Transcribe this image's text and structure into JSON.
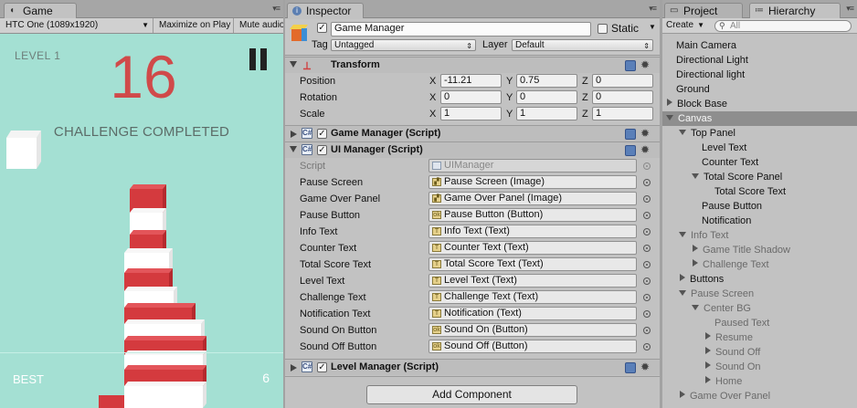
{
  "game": {
    "tab_label": "Game",
    "resolution": "HTC One (1089x1920)",
    "maximize": "Maximize on Play",
    "mute": "Mute audio",
    "level": "LEVEL 1",
    "counter": "16",
    "challenge": "CHALLENGE COMPLETED",
    "best_label": "BEST",
    "best_value": "6",
    "colors": {
      "background": "#a4e0d3",
      "red": "#d43a3e",
      "white": "#ffffff"
    }
  },
  "inspector": {
    "tab_label": "Inspector",
    "object_name": "Game Manager",
    "static_label": "Static",
    "tag_label": "Tag",
    "tag_value": "Untagged",
    "layer_label": "Layer",
    "layer_value": "Default",
    "transform": {
      "title": "Transform",
      "rows": [
        {
          "label": "Position",
          "x": "-11.21",
          "y": "0.75",
          "z": "0"
        },
        {
          "label": "Rotation",
          "x": "0",
          "y": "0",
          "z": "0"
        },
        {
          "label": "Scale",
          "x": "1",
          "y": "1",
          "z": "1"
        }
      ],
      "x_label": "X",
      "y_label": "Y",
      "z_label": "Z"
    },
    "game_manager_title": "Game Manager (Script)",
    "ui_manager_title": "UI Manager (Script)",
    "script_label": "Script",
    "script_value": "UIManager",
    "fields": [
      {
        "label": "Pause Screen",
        "value": "Pause Screen (Image)"
      },
      {
        "label": "Game Over Panel",
        "value": "Game Over Panel (Image)"
      },
      {
        "label": "Pause Button",
        "value": "Pause Button (Button)"
      },
      {
        "label": "Info Text",
        "value": "Info Text (Text)"
      },
      {
        "label": "Counter Text",
        "value": "Counter Text (Text)"
      },
      {
        "label": "Total Score Text",
        "value": "Total Score Text (Text)"
      },
      {
        "label": "Level Text",
        "value": "Level Text (Text)"
      },
      {
        "label": "Challenge Text",
        "value": "Challenge Text (Text)"
      },
      {
        "label": "Notification Text",
        "value": "Notification (Text)"
      },
      {
        "label": "Sound On Button",
        "value": "Sound On (Button)"
      },
      {
        "label": "Sound Off Button",
        "value": "Sound Off (Button)"
      }
    ],
    "level_manager_title": "Level Manager (Script)",
    "add_component": "Add Component"
  },
  "hierarchy": {
    "project_tab": "Project",
    "hierarchy_tab": "Hierarchy",
    "create_label": "Create",
    "search_placeholder": "All",
    "items": [
      {
        "label": "Main Camera",
        "depth": 0,
        "fold": "none",
        "state": "normal"
      },
      {
        "label": "Directional Light",
        "depth": 0,
        "fold": "none",
        "state": "normal"
      },
      {
        "label": "Directional light",
        "depth": 0,
        "fold": "none",
        "state": "normal"
      },
      {
        "label": "Ground",
        "depth": 0,
        "fold": "none",
        "state": "normal"
      },
      {
        "label": "Block Base",
        "depth": 0,
        "fold": "closed",
        "state": "normal"
      },
      {
        "label": "Canvas",
        "depth": 0,
        "fold": "open",
        "state": "selected"
      },
      {
        "label": "Top Panel",
        "depth": 1,
        "fold": "open",
        "state": "normal"
      },
      {
        "label": "Level Text",
        "depth": 2,
        "fold": "none",
        "state": "normal"
      },
      {
        "label": "Counter Text",
        "depth": 2,
        "fold": "none",
        "state": "normal"
      },
      {
        "label": "Total Score Panel",
        "depth": 2,
        "fold": "open",
        "state": "normal"
      },
      {
        "label": "Total Score Text",
        "depth": 3,
        "fold": "none",
        "state": "normal"
      },
      {
        "label": "Pause Button",
        "depth": 2,
        "fold": "none",
        "state": "normal"
      },
      {
        "label": "Notification",
        "depth": 2,
        "fold": "none",
        "state": "normal"
      },
      {
        "label": "Info Text",
        "depth": 1,
        "fold": "open",
        "state": "inactive"
      },
      {
        "label": "Game Title Shadow",
        "depth": 2,
        "fold": "closed",
        "state": "inactive"
      },
      {
        "label": "Challenge Text",
        "depth": 2,
        "fold": "closed",
        "state": "inactive"
      },
      {
        "label": "Buttons",
        "depth": 1,
        "fold": "closed",
        "state": "normal"
      },
      {
        "label": "Pause Screen",
        "depth": 1,
        "fold": "open",
        "state": "inactive"
      },
      {
        "label": "Center BG",
        "depth": 2,
        "fold": "open",
        "state": "inactive"
      },
      {
        "label": "Paused Text",
        "depth": 3,
        "fold": "none",
        "state": "inactive"
      },
      {
        "label": "Resume",
        "depth": 3,
        "fold": "closed",
        "state": "inactive"
      },
      {
        "label": "Sound Off",
        "depth": 3,
        "fold": "closed",
        "state": "inactive"
      },
      {
        "label": "Sound On",
        "depth": 3,
        "fold": "closed",
        "state": "inactive"
      },
      {
        "label": "Home",
        "depth": 3,
        "fold": "closed",
        "state": "inactive"
      },
      {
        "label": "Game Over Panel",
        "depth": 1,
        "fold": "closed",
        "state": "inactive"
      }
    ]
  }
}
